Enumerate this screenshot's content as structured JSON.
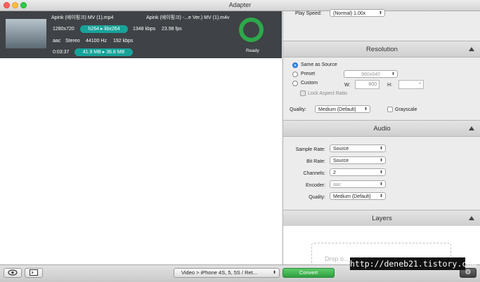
{
  "window": {
    "title": "Adapter"
  },
  "job": {
    "source_name": "Apink (에이핑크) MV (1).mp4",
    "output_name": "Apink (에이핑크) -...e Ver.) MV (1).m4v",
    "resolution": "1280x720",
    "codec": "h264 ▸ libx264",
    "bitrate": "1348 kbps",
    "fps": "23.98 fps",
    "audio_codec": "aac",
    "channels": "Stereo",
    "sample_rate": "44100 Hz",
    "audio_bitrate": "192 kbps",
    "duration": "0:03:37",
    "size": "41.9 MB ▸ 36.8 MB",
    "status": "Ready"
  },
  "top": {
    "play_speed_label": "Play Speed:",
    "play_speed_value": "(Normal) 1.00x"
  },
  "resolution": {
    "header": "Resolution",
    "same_as_source": "Same as Source",
    "preset": "Preset",
    "preset_value": "960x640",
    "custom": "Custom",
    "w_label": "W:",
    "w_value": "800",
    "h_label": "H:",
    "h_value": "*",
    "lock_aspect": "Lock Aspect Ratio",
    "quality_label": "Quality:",
    "quality_value": "Medium (Default)",
    "grayscale": "Grayscale"
  },
  "audio": {
    "header": "Audio",
    "sample_rate_label": "Sample Rate:",
    "sample_rate_value": "Source",
    "bit_rate_label": "Bit Rate:",
    "bit_rate_value": "Source",
    "channels_label": "Channels:",
    "channels_value": "2",
    "encoder_label": "Encoder:",
    "encoder_value": "aac",
    "quality_label": "Quality:",
    "quality_value": "Medium (Default)"
  },
  "layers": {
    "header": "Layers",
    "drop_text": "Drop o..."
  },
  "bottom": {
    "preset_select": "Video > iPhone 4S, 5, 5S / Ret...",
    "convert": "Convert"
  },
  "watermark": "http://deneb21.tistory.com",
  "colors": {
    "accent": "#17a39a",
    "ready": "#2ea84b",
    "convert": "#35b147"
  }
}
